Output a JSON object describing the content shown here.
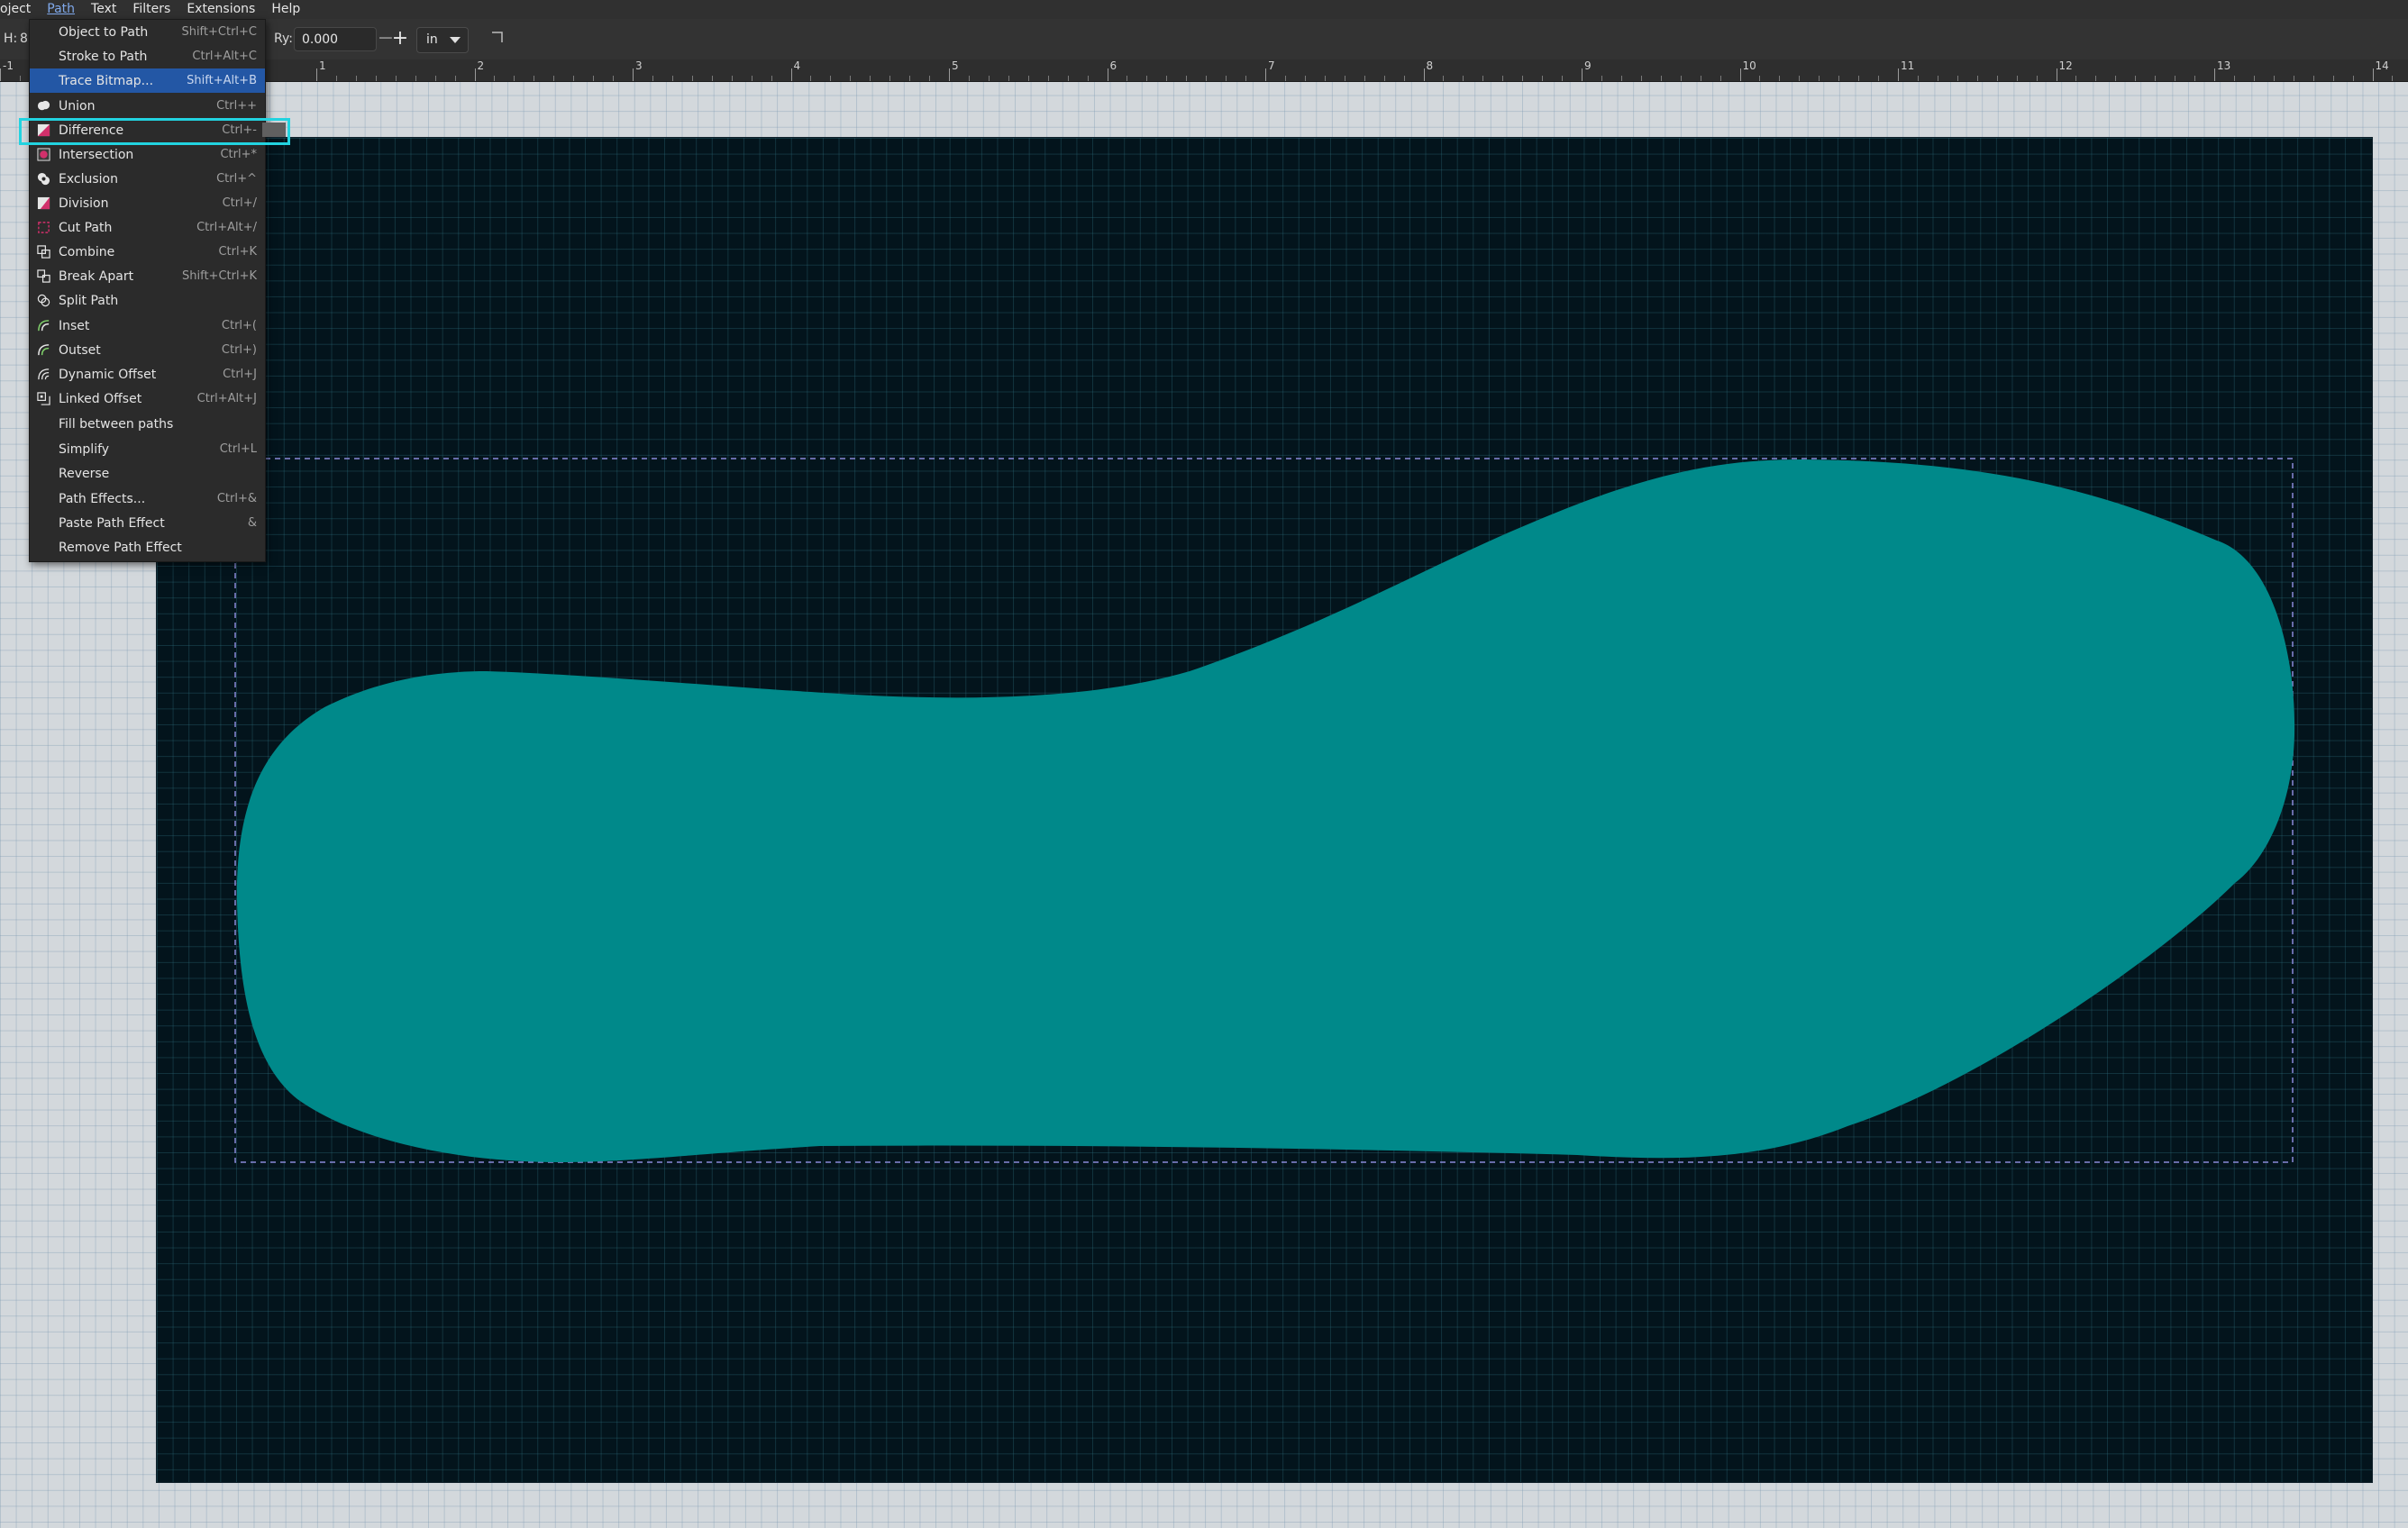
{
  "menubar": {
    "items": [
      "oject",
      "Path",
      "Text",
      "Filters",
      "Extensions",
      "Help"
    ]
  },
  "toolbar": {
    "h_label": "H:",
    "h_value": "8",
    "ry_label": "Ry:",
    "ry_value": "0.000",
    "minus": "−",
    "plus": "+",
    "unit": "in"
  },
  "ruler": {
    "labels": [
      "-1",
      "1",
      "2",
      "3",
      "4",
      "5",
      "6",
      "7",
      "8",
      "9",
      "10",
      "11",
      "12",
      "13",
      "14"
    ]
  },
  "path_menu": {
    "items": [
      {
        "label": "Object to Path",
        "shortcut": "Shift+Ctrl+C",
        "icon": "none"
      },
      {
        "label": "Stroke to Path",
        "shortcut": "Ctrl+Alt+C",
        "icon": "none"
      },
      {
        "label": "Trace Bitmap...",
        "shortcut": "Shift+Alt+B",
        "icon": "none"
      },
      {
        "label": "Union",
        "shortcut": "Ctrl++",
        "icon": "union-icon"
      },
      {
        "label": "Difference",
        "shortcut": "Ctrl+-",
        "icon": "difference-icon"
      },
      {
        "label": "Intersection",
        "shortcut": "Ctrl+*",
        "icon": "intersection-icon"
      },
      {
        "label": "Exclusion",
        "shortcut": "Ctrl+^",
        "icon": "exclusion-icon"
      },
      {
        "label": "Division",
        "shortcut": "Ctrl+/",
        "icon": "division-icon"
      },
      {
        "label": "Cut Path",
        "shortcut": "Ctrl+Alt+/",
        "icon": "cut-path-icon"
      },
      {
        "label": "Combine",
        "shortcut": "Ctrl+K",
        "icon": "combine-icon"
      },
      {
        "label": "Break Apart",
        "shortcut": "Shift+Ctrl+K",
        "icon": "break-apart-icon"
      },
      {
        "label": "Split Path",
        "shortcut": "",
        "icon": "split-path-icon"
      },
      {
        "label": "Inset",
        "shortcut": "Ctrl+(",
        "icon": "inset-icon"
      },
      {
        "label": "Outset",
        "shortcut": "Ctrl+)",
        "icon": "outset-icon"
      },
      {
        "label": "Dynamic Offset",
        "shortcut": "Ctrl+J",
        "icon": "dynamic-offset-icon"
      },
      {
        "label": "Linked Offset",
        "shortcut": "Ctrl+Alt+J",
        "icon": "linked-offset-icon"
      },
      {
        "label": "Fill between paths",
        "shortcut": "",
        "icon": "none"
      },
      {
        "label": "Simplify",
        "shortcut": "Ctrl+L",
        "icon": "none"
      },
      {
        "label": "Reverse",
        "shortcut": "",
        "icon": "none"
      },
      {
        "label": "Path Effects...",
        "shortcut": "Ctrl+&",
        "icon": "none"
      },
      {
        "label": "Paste Path Effect",
        "shortcut": "&",
        "icon": "none"
      },
      {
        "label": "Remove Path Effect",
        "shortcut": "",
        "icon": "none"
      }
    ]
  },
  "colors": {
    "menu_highlight": "#2357a5",
    "focus_outline": "#22d3e0",
    "shape_fill": "#00898a",
    "page_bg": "#03141c"
  }
}
